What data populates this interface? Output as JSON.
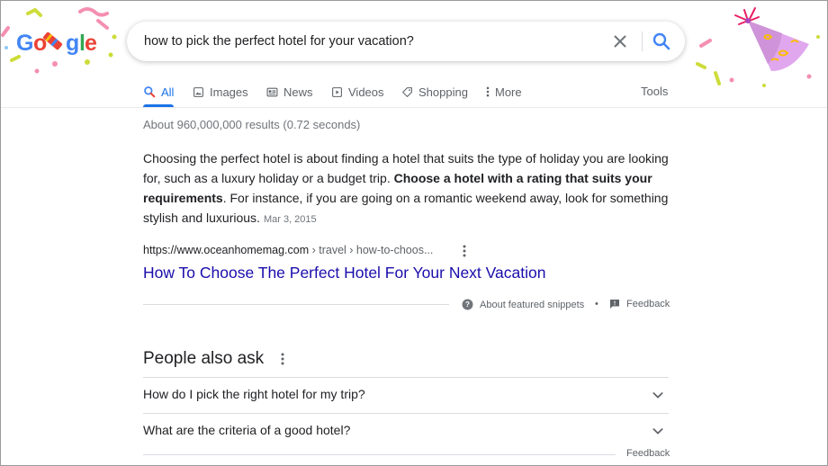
{
  "logo": {
    "text": "Google",
    "style": "doodle"
  },
  "search": {
    "query": "how to pick the perfect hotel for your vacation?",
    "clear_icon": "close-icon",
    "search_icon": "search-icon"
  },
  "tabs": [
    {
      "label": "All",
      "icon": "search-icon",
      "active": true
    },
    {
      "label": "Images",
      "icon": "image-icon"
    },
    {
      "label": "News",
      "icon": "news-icon"
    },
    {
      "label": "Videos",
      "icon": "video-icon"
    },
    {
      "label": "Shopping",
      "icon": "tag-icon"
    },
    {
      "label": "More",
      "icon": "more-vert-icon"
    }
  ],
  "tools_label": "Tools",
  "result_stats": "About 960,000,000 results (0.72 seconds)",
  "featured_snippet": {
    "text_before": "Choosing the perfect hotel is about finding a hotel that suits the type of holiday you are looking for, such as a luxury holiday or a budget trip. ",
    "text_bold": "Choose a hotel with a rating that suits your requirements",
    "text_after": ". For instance, if you are going on a romantic weekend away, look for something stylish and luxurious.",
    "date": "Mar 3, 2015",
    "cite_domain": "https://www.oceanhomemag.com",
    "cite_path": " › travel › how-to-choos...",
    "title": "How To Choose The Perfect Hotel For Your Next Vacation",
    "about_label": "About featured snippets",
    "separator": "•",
    "feedback_label": "Feedback"
  },
  "people_also_ask": {
    "title": "People also ask",
    "questions": [
      "How do I pick the right hotel for my trip?",
      "What are the criteria of a good hotel?"
    ],
    "feedback_label": "Feedback"
  },
  "colors": {
    "link": "#1a0dab",
    "accent": "#1a73e8",
    "muted": "#70757a"
  }
}
